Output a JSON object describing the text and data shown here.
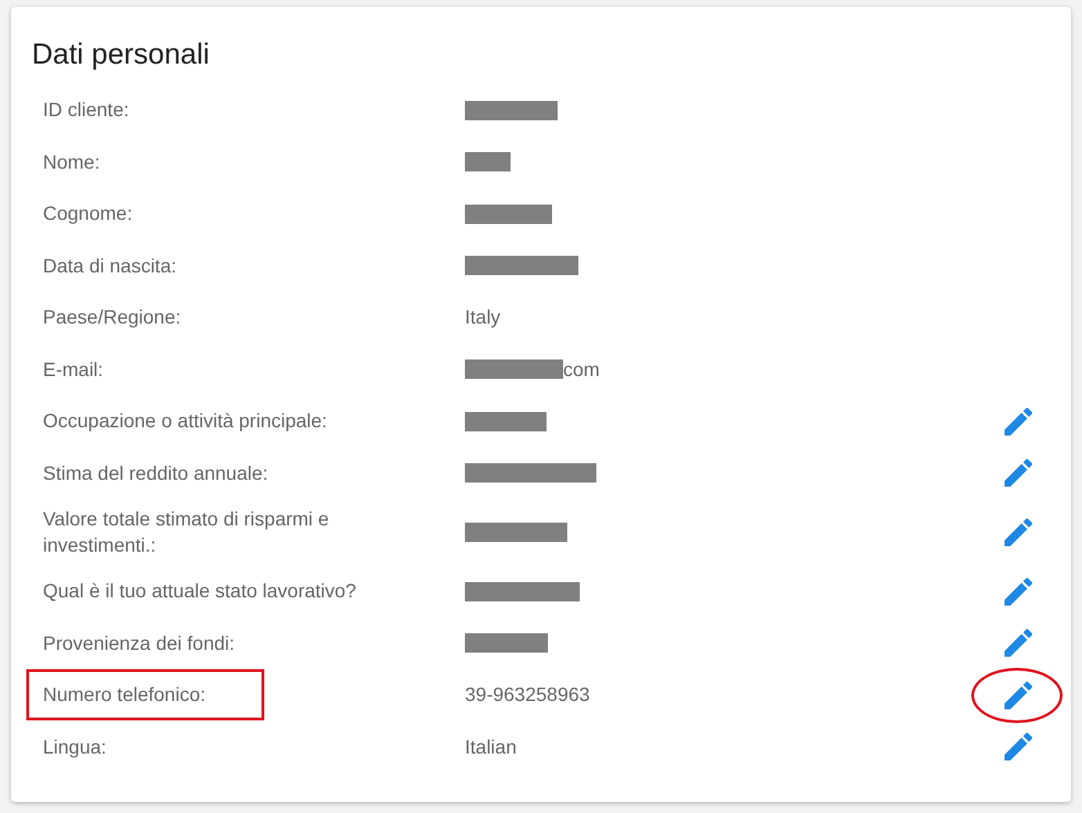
{
  "title": "Dati personali",
  "rows": [
    {
      "label": "ID cliente:",
      "value": {
        "kind": "redacted"
      },
      "editable": false,
      "boxed": false,
      "circled": false
    },
    {
      "label": "Nome:",
      "value": {
        "kind": "redacted"
      },
      "editable": false,
      "boxed": false,
      "circled": false
    },
    {
      "label": "Cognome:",
      "value": {
        "kind": "redacted"
      },
      "editable": false,
      "boxed": false,
      "circled": false
    },
    {
      "label": "Data di nascita:",
      "value": {
        "kind": "redacted"
      },
      "editable": false,
      "boxed": false,
      "circled": false
    },
    {
      "label": "Paese/Regione:",
      "value": {
        "kind": "text",
        "text": "Italy"
      },
      "editable": false,
      "boxed": false,
      "circled": false
    },
    {
      "label": "E-mail:",
      "value": {
        "kind": "redacted_suffix",
        "text": "com"
      },
      "editable": false,
      "boxed": false,
      "circled": false
    },
    {
      "label": "Occupazione o attività principale:",
      "value": {
        "kind": "redacted"
      },
      "editable": true,
      "boxed": false,
      "circled": false
    },
    {
      "label": "Stima del reddito annuale:",
      "value": {
        "kind": "redacted"
      },
      "editable": true,
      "boxed": false,
      "circled": false
    },
    {
      "label": "Valore totale stimato di risparmi e investimenti.:",
      "value": {
        "kind": "redacted"
      },
      "editable": true,
      "boxed": false,
      "circled": false
    },
    {
      "label": "Qual è il tuo attuale stato lavorativo?",
      "value": {
        "kind": "redacted"
      },
      "editable": true,
      "boxed": false,
      "circled": false
    },
    {
      "label": "Provenienza dei fondi:",
      "value": {
        "kind": "redacted"
      },
      "editable": true,
      "boxed": false,
      "circled": false
    },
    {
      "label": "Numero telefonico:",
      "value": {
        "kind": "text",
        "text": "39-963258963"
      },
      "editable": true,
      "boxed": true,
      "circled": true
    },
    {
      "label": "Lingua:",
      "value": {
        "kind": "text",
        "text": "Italian"
      },
      "editable": true,
      "boxed": false,
      "circled": false
    }
  ]
}
